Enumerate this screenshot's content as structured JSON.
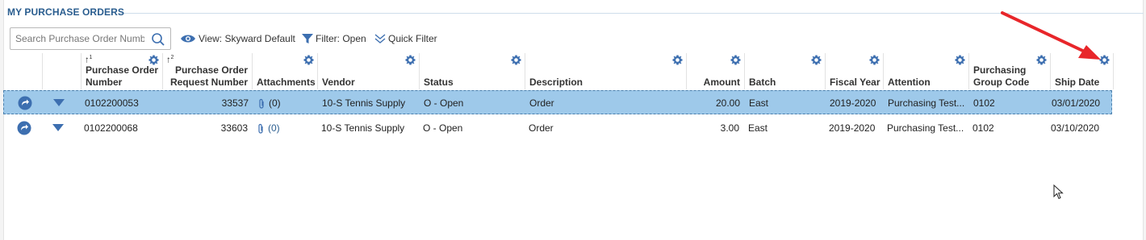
{
  "title": "MY PURCHASE ORDERS",
  "toolbar": {
    "search_placeholder": "Search Purchase Order Number",
    "view_label": "View: Skyward Default",
    "filter_label": "Filter: Open",
    "quick_filter_label": "Quick Filter"
  },
  "columns": {
    "po_number_line1": "Purchase Order",
    "po_number_line2": "Number",
    "po_number_sort": "1",
    "por_number_line1": "Purchase Order",
    "por_number_line2": "Request Number",
    "por_number_sort": "2",
    "attachments": "Attachments",
    "vendor": "Vendor",
    "status": "Status",
    "description": "Description",
    "amount": "Amount",
    "batch": "Batch",
    "fiscal_year": "Fiscal Year",
    "attention": "Attention",
    "purchasing_group_line1": "Purchasing",
    "purchasing_group_line2": "Group Code",
    "ship_date": "Ship Date"
  },
  "rows": [
    {
      "po_number": "0102200053",
      "por_number": "33537",
      "attachments": "(0)",
      "vendor": "10-S Tennis Supply",
      "status": "O - Open",
      "description": "Order",
      "amount": "20.00",
      "batch": "East",
      "fiscal_year": "2019-2020",
      "attention": "Purchasing Test...",
      "purchasing_group": "0102",
      "ship_date": "03/01/2020",
      "selected": true
    },
    {
      "po_number": "0102200068",
      "por_number": "33603",
      "attachments": "(0)",
      "vendor": "10-S Tennis Supply",
      "status": "O - Open",
      "description": "Order",
      "amount": "3.00",
      "batch": "East",
      "fiscal_year": "2019-2020",
      "attention": "Purchasing Test...",
      "purchasing_group": "0102",
      "ship_date": "03/10/2020",
      "selected": false
    }
  ],
  "colors": {
    "accent": "#2a5d8f",
    "selected_row": "#9ec9ea",
    "icon_blue": "#3d6fb0",
    "annotation_arrow": "#e8262a"
  },
  "icons": {
    "row_action": "go-arrow-icon",
    "row_expand": "expand-triangle-icon",
    "attachment": "paperclip-icon",
    "column_settings": "gear-icon"
  }
}
